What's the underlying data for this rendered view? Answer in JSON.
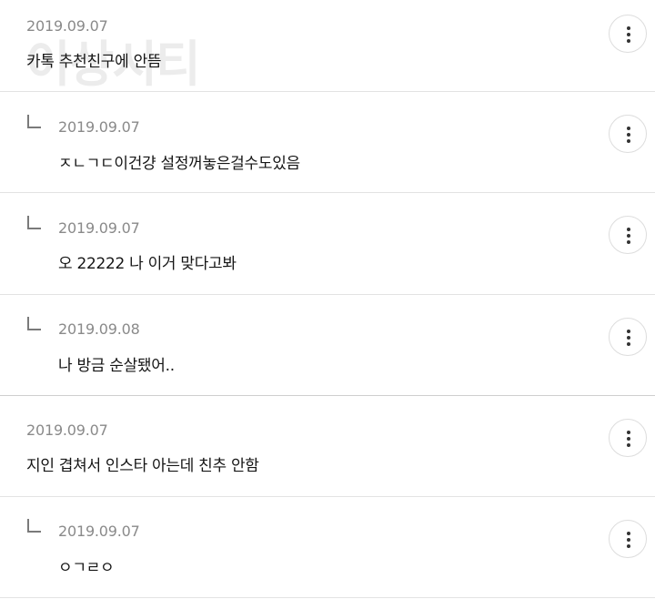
{
  "watermark": "이상시티",
  "comments": [
    {
      "date": "2019.09.07",
      "text": "카톡 추천친구에 안뜸",
      "reply": false
    },
    {
      "date": "2019.09.07",
      "text": "ㅈㄴㄱㄷ이건걍 설정꺼놓은걸수도있음",
      "reply": true
    },
    {
      "date": "2019.09.07",
      "text": "오 22222 나 이거 맞다고봐",
      "reply": true
    },
    {
      "date": "2019.09.08",
      "text": "나 방금 순살됐어..",
      "reply": true
    },
    {
      "date": "2019.09.07",
      "text": "지인 겹쳐서 인스타 아는데 친추 안함",
      "reply": false
    },
    {
      "date": "2019.09.07",
      "text": "ㅇㄱㄹㅇ",
      "reply": true
    }
  ],
  "icons": {
    "reply": "reply-arrow-icon",
    "more": "more-vertical-icon"
  },
  "colors": {
    "date": "#8a8a8a",
    "text": "#151515",
    "divider": "#e3e3e3"
  }
}
